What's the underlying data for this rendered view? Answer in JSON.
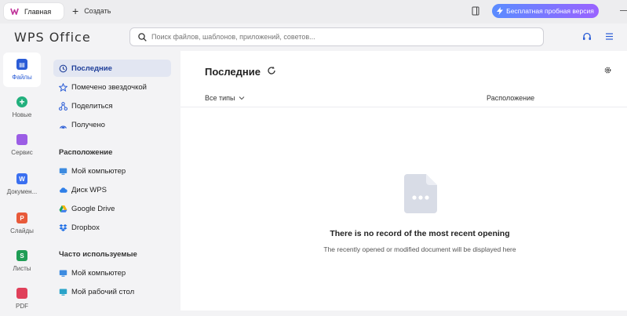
{
  "titlebar": {
    "home_tab": "Главная",
    "create_label": "Создать",
    "trial_button": "Бесплатная пробная версия",
    "trial_colors": [
      "#5a8cff",
      "#9a62ff"
    ]
  },
  "header": {
    "brand": "WPS Office",
    "search_placeholder": "Поиск файлов, шаблонов, приложений, советов..."
  },
  "rail": {
    "items": [
      {
        "label": "Файлы",
        "icon": "files-icon",
        "color": "#2a5cd6",
        "active": true
      },
      {
        "label": "Новые",
        "icon": "new-plus-icon",
        "color": "#22b07d"
      },
      {
        "label": "Сервис",
        "icon": "services-icon",
        "color": "#9b5de5"
      },
      {
        "label": "Докумен...",
        "icon": "writer-icon",
        "color": "#3a6ff0",
        "letter": "W"
      },
      {
        "label": "Слайды",
        "icon": "slides-icon",
        "color": "#e85a3a",
        "letter": "P"
      },
      {
        "label": "Листы",
        "icon": "sheets-icon",
        "color": "#1f9d55",
        "letter": "S"
      },
      {
        "label": "PDF",
        "icon": "pdf-icon",
        "color": "#e0405a"
      }
    ]
  },
  "sidebar": {
    "nav": [
      {
        "label": "Последние",
        "icon": "clock-icon",
        "active": true
      },
      {
        "label": "Помечено звездочкой",
        "icon": "star-icon"
      },
      {
        "label": "Поделиться",
        "icon": "share-icon"
      },
      {
        "label": "Получено",
        "icon": "received-icon"
      }
    ],
    "location_title": "Расположение",
    "locations": [
      {
        "label": "Мой компьютер",
        "icon": "computer-icon"
      },
      {
        "label": "Диск WPS",
        "icon": "cloud-icon"
      },
      {
        "label": "Google Drive",
        "icon": "google-drive-icon"
      },
      {
        "label": "Dropbox",
        "icon": "dropbox-icon"
      }
    ],
    "frequent_title": "Часто используемые",
    "frequent": [
      {
        "label": "Мой компьютер",
        "icon": "computer-icon"
      },
      {
        "label": "Мой рабочий стол",
        "icon": "desktop-icon"
      }
    ]
  },
  "main": {
    "title": "Последние",
    "filter_label": "Все типы",
    "location_col": "Расположение",
    "empty_title": "There is no record of the most recent opening",
    "empty_desc": "The recently opened or modified document will be displayed here"
  }
}
